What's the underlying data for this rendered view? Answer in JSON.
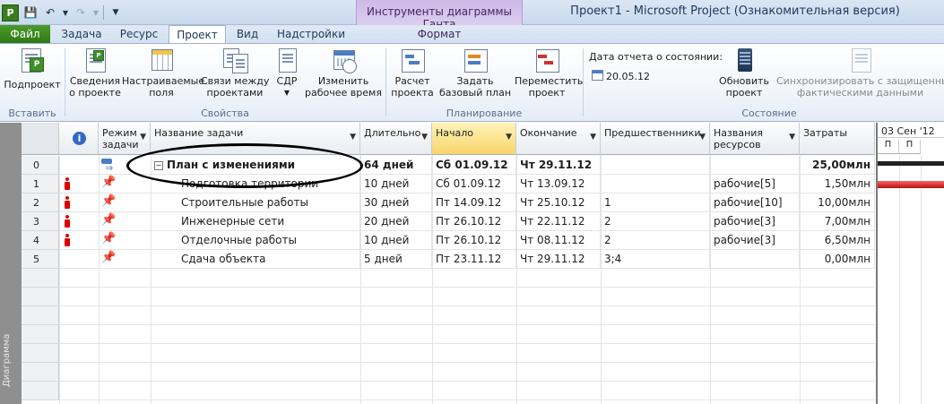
{
  "app": {
    "window_title": "Проект1  -  Microsoft Project (Ознакомительная версия)",
    "context_tools_title": "Инструменты диаграммы Ганта"
  },
  "tabs": [
    {
      "label": "Файл"
    },
    {
      "label": "Задача"
    },
    {
      "label": "Ресурс"
    },
    {
      "label": "Проект",
      "active": true
    },
    {
      "label": "Вид"
    },
    {
      "label": "Надстройки"
    },
    {
      "label": "Формат"
    }
  ],
  "ribbon": {
    "groups": [
      {
        "label": "Вставить"
      },
      {
        "label": "Свойства"
      },
      {
        "label": "Планирование"
      },
      {
        "label": "Состояние"
      }
    ],
    "buttons": {
      "subproject": "Подпроект",
      "project_info_1": "Сведения",
      "project_info_2": "о проекте",
      "custom_fields_1": "Настраиваемые",
      "custom_fields_2": "поля",
      "links_1": "Связи между",
      "links_2": "проектами",
      "wbs": "СДР",
      "change_time_1": "Изменить",
      "change_time_2": "рабочее время",
      "calc_1": "Расчет",
      "calc_2": "проекта",
      "baseline_1": "Задать",
      "baseline_2": "базовый план",
      "move_1": "Переместить",
      "move_2": "проект",
      "update_1": "Обновить",
      "update_2": "проект",
      "sync_1": "Синхронизировать с защищенными",
      "sync_2": "фактическими данными"
    },
    "status_date": {
      "label": "Дата отчета о состоянии:",
      "value": "20.05.12"
    }
  },
  "table": {
    "columns": [
      {
        "key": "mode",
        "label_1": "Режим",
        "label_2": "задачи"
      },
      {
        "key": "name",
        "label": "Название задачи"
      },
      {
        "key": "duration",
        "label": "Длительно"
      },
      {
        "key": "start",
        "label": "Начало"
      },
      {
        "key": "finish",
        "label": "Окончание"
      },
      {
        "key": "predecessors",
        "label": "Предшественники"
      },
      {
        "key": "resources",
        "label_1": "Названия",
        "label_2": "ресурсов"
      },
      {
        "key": "cost",
        "label": "Затраты"
      }
    ],
    "rows": [
      {
        "id": "0",
        "name": "План с изменениями",
        "duration": "64 дней",
        "start": "Сб 01.09.12",
        "finish": "Чт 29.11.12",
        "predecessors": "",
        "resources": "",
        "cost": "25,00млн",
        "summary": true
      },
      {
        "id": "1",
        "name": "Подготовка территории",
        "duration": "10 дней",
        "start": "Сб 01.09.12",
        "finish": "Чт 13.09.12",
        "predecessors": "",
        "resources": "рабочие[5]",
        "cost": "1,50млн"
      },
      {
        "id": "2",
        "name": "Строительные работы",
        "duration": "30 дней",
        "start": "Пт 14.09.12",
        "finish": "Чт 25.10.12",
        "predecessors": "1",
        "resources": "рабочие[10]",
        "cost": "10,00млн"
      },
      {
        "id": "3",
        "name": "Инженерные сети",
        "duration": "20 дней",
        "start": "Пт 26.10.12",
        "finish": "Чт 22.11.12",
        "predecessors": "2",
        "resources": "рабочие[3]",
        "cost": "7,00млн"
      },
      {
        "id": "4",
        "name": "Отделочные работы",
        "duration": "10 дней",
        "start": "Пт 26.10.12",
        "finish": "Чт 08.11.12",
        "predecessors": "2",
        "resources": "рабочие[3]",
        "cost": "6,50млн"
      },
      {
        "id": "5",
        "name": "Сдача объекта",
        "duration": "5 дней",
        "start": "Пт 23.11.12",
        "finish": "Чт 29.11.12",
        "predecessors": "3;4",
        "resources": "",
        "cost": "0,00млн"
      }
    ]
  },
  "timescale": {
    "top": "03 Сен '12",
    "days": [
      "П",
      "П"
    ]
  },
  "side_strip_text": "Диаграмма",
  "colors": {
    "file_tab": "#3f8a22",
    "context_tab": "#cdb9e6",
    "selected_column": "#f7d56b",
    "task_bar": "#d01010",
    "indicator": "#dd0000"
  }
}
